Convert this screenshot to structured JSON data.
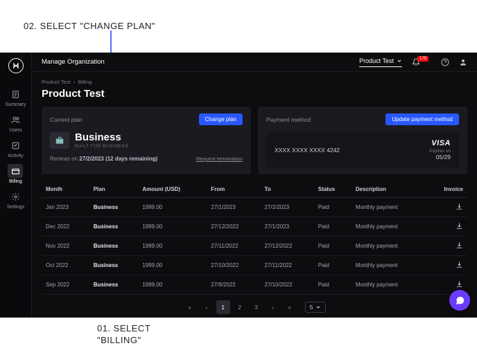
{
  "instructions": {
    "top": "02. SELECT \"CHANGE PLAN\"",
    "bottom_line1": "01. SELECT",
    "bottom_line2": "\"BILLING\""
  },
  "topbar": {
    "title": "Manage Organization",
    "product_label": "Product Test",
    "notification_count": "175"
  },
  "sidebar": {
    "items": [
      {
        "label": "Summary",
        "icon": "document"
      },
      {
        "label": "Users",
        "icon": "users"
      },
      {
        "label": "Activity",
        "icon": "activity"
      },
      {
        "label": "Billing",
        "icon": "billing",
        "active": true
      },
      {
        "label": "Settings",
        "icon": "gear"
      }
    ]
  },
  "breadcrumb": {
    "org": "Product Test",
    "page": "Billing"
  },
  "page_title": "Product Test",
  "current_plan": {
    "card_title": "Current plan",
    "button": "Change plan",
    "name": "Business",
    "subtitle": "BUILT FOR BUSINESS",
    "renew_prefix": "Renews on ",
    "renew_date": "27/2/2023 (12 days remaining)",
    "request_termination": "Request termination"
  },
  "payment": {
    "card_title": "Payment method",
    "button": "Update payment method",
    "number": "XXXX XXXX XXXX 4242",
    "brand": "VISA",
    "expires_label": "Expires on",
    "expires": "05/29"
  },
  "table": {
    "columns": [
      "Month",
      "Plan",
      "Amount (USD)",
      "From",
      "To",
      "Status",
      "Description",
      "Invoice"
    ],
    "rows": [
      {
        "month": "Jan 2023",
        "plan": "Business",
        "amount": "1999.00",
        "from": "27/1/2023",
        "to": "27/2/2023",
        "status": "Paid",
        "desc": "Monthly payment"
      },
      {
        "month": "Dec 2022",
        "plan": "Business",
        "amount": "1999.00",
        "from": "27/12/2022",
        "to": "27/1/2023",
        "status": "Paid",
        "desc": "Monthly payment"
      },
      {
        "month": "Nov 2022",
        "plan": "Business",
        "amount": "1999.00",
        "from": "27/11/2022",
        "to": "27/12/2022",
        "status": "Paid",
        "desc": "Monthly payment"
      },
      {
        "month": "Oct 2022",
        "plan": "Business",
        "amount": "1999.00",
        "from": "27/10/2022",
        "to": "27/11/2022",
        "status": "Paid",
        "desc": "Monthly payment"
      },
      {
        "month": "Sep 2022",
        "plan": "Business",
        "amount": "1999.00",
        "from": "27/9/2022",
        "to": "27/10/2022",
        "status": "Paid",
        "desc": "Monthly payment"
      }
    ]
  },
  "pagination": {
    "pages": [
      "1",
      "2",
      "3"
    ],
    "active": "1",
    "page_size": "5"
  }
}
